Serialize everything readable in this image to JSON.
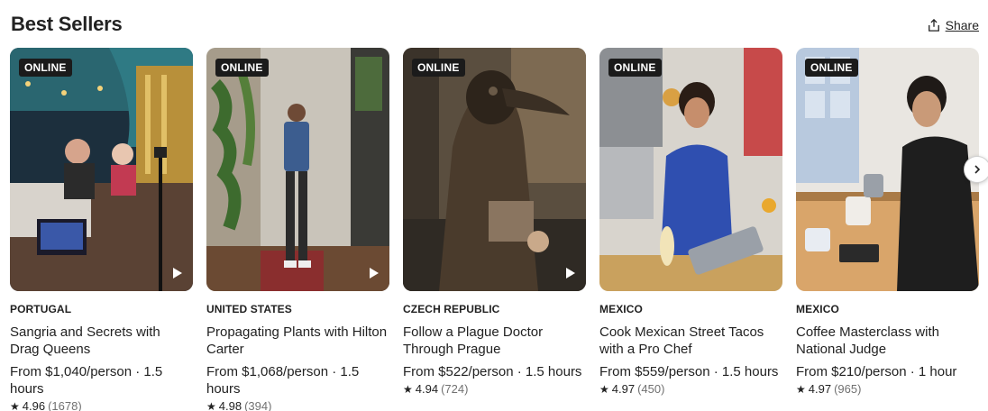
{
  "header": {
    "title": "Best Sellers",
    "share_label": "Share"
  },
  "cards": [
    {
      "badge": "ONLINE",
      "country": "PORTUGAL",
      "name": "Sangria and Secrets with Drag Queens",
      "price": "From $1,040/person · 1.5 hours",
      "rating": "4.96",
      "reviews": "(1678)",
      "has_video": true
    },
    {
      "badge": "ONLINE",
      "country": "UNITED STATES",
      "name": "Propagating Plants with Hilton Carter",
      "price": "From $1,068/person · 1.5 hours",
      "rating": "4.98",
      "reviews": "(394)",
      "has_video": true
    },
    {
      "badge": "ONLINE",
      "country": "CZECH REPUBLIC",
      "name": "Follow a Plague Doctor Through Prague",
      "price": "From $522/person · 1.5 hours",
      "rating": "4.94",
      "reviews": "(724)",
      "has_video": true
    },
    {
      "badge": "ONLINE",
      "country": "MEXICO",
      "name": "Cook Mexican Street Tacos with a Pro Chef",
      "price": "From $559/person · 1.5 hours",
      "rating": "4.97",
      "reviews": "(450)",
      "has_video": false
    },
    {
      "badge": "ONLINE",
      "country": "MEXICO",
      "name": "Coffee Masterclass with National Judge",
      "price": "From $210/person · 1 hour",
      "rating": "4.97",
      "reviews": "(965)",
      "has_video": false
    }
  ],
  "icons": {
    "share": "share-icon",
    "star": "star-icon",
    "play": "play-icon",
    "next": "chevron-right-icon"
  }
}
